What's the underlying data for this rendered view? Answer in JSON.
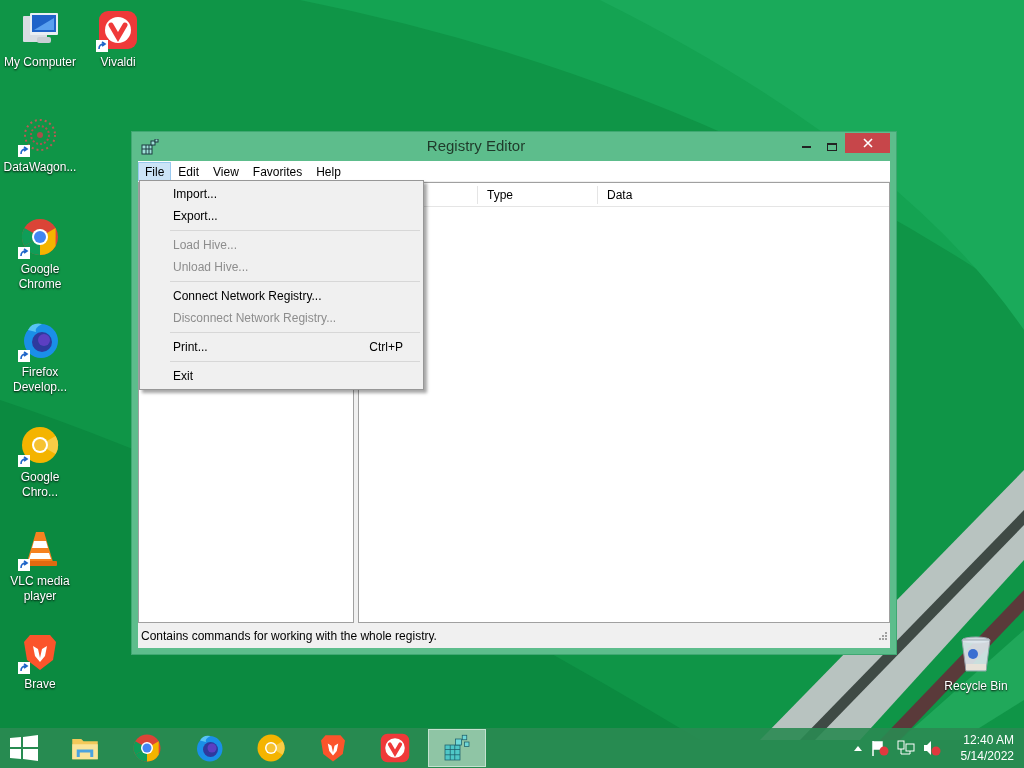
{
  "desktop_icons": [
    {
      "kind": "computer",
      "label": "My Computer",
      "shortcut": false
    },
    {
      "kind": "vivaldi",
      "label": "Vivaldi",
      "shortcut": true
    },
    {
      "kind": "datawagon",
      "label": "DataWagon...",
      "shortcut": true
    },
    {
      "kind": "chrome",
      "label": "Google Chrome",
      "shortcut": true
    },
    {
      "kind": "firefox",
      "label": "Firefox Develop...",
      "shortcut": true
    },
    {
      "kind": "canary",
      "label": "Google Chro...",
      "shortcut": true
    },
    {
      "kind": "vlc",
      "label": "VLC media player",
      "shortcut": true
    },
    {
      "kind": "brave",
      "label": "Brave",
      "shortcut": true
    },
    {
      "kind": "recycle",
      "label": "Recycle Bin",
      "shortcut": false
    }
  ],
  "window": {
    "title": "Registry Editor",
    "menu_bar": [
      {
        "label": "File",
        "selected": true
      },
      {
        "label": "Edit",
        "selected": false
      },
      {
        "label": "View",
        "selected": false
      },
      {
        "label": "Favorites",
        "selected": false
      },
      {
        "label": "Help",
        "selected": false
      }
    ],
    "columns": [
      "Type",
      "Data"
    ],
    "status_bar": "Contains commands for working with the whole registry."
  },
  "file_menu": [
    {
      "kind": "item",
      "label": "Import...",
      "disabled": false
    },
    {
      "kind": "item",
      "label": "Export...",
      "disabled": false
    },
    {
      "kind": "separator"
    },
    {
      "kind": "item",
      "label": "Load Hive...",
      "disabled": true
    },
    {
      "kind": "item",
      "label": "Unload Hive...",
      "disabled": true
    },
    {
      "kind": "separator"
    },
    {
      "kind": "item",
      "label": "Connect Network Registry...",
      "disabled": false
    },
    {
      "kind": "item",
      "label": "Disconnect Network Registry...",
      "disabled": true
    },
    {
      "kind": "separator"
    },
    {
      "kind": "item",
      "label": "Print...",
      "disabled": false,
      "shortcut": "Ctrl+P"
    },
    {
      "kind": "separator"
    },
    {
      "kind": "item",
      "label": "Exit",
      "disabled": false
    }
  ],
  "taskbar": {
    "apps": [
      {
        "kind": "explorer",
        "selected": false
      },
      {
        "kind": "chrome",
        "selected": false
      },
      {
        "kind": "firefox",
        "selected": false
      },
      {
        "kind": "canary",
        "selected": false
      },
      {
        "kind": "brave",
        "selected": false
      },
      {
        "kind": "vivaldi",
        "selected": false
      },
      {
        "kind": "regedit",
        "selected": true
      }
    ],
    "time": "12:40 AM",
    "date": "5/14/2022"
  }
}
